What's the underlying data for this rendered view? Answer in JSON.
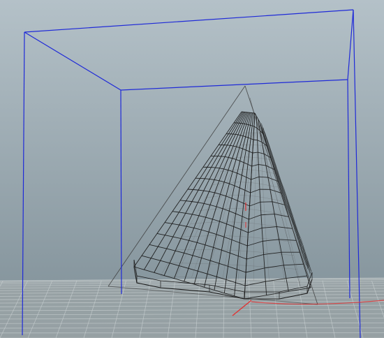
{
  "viewport": {
    "kind": "3d-wireframe-viewport",
    "background_top": "#b4c1c8",
    "background_bottom": "#7e8e96",
    "floor_color": "#9aa3a6",
    "grid_color": "#c9d0d2",
    "bounding_box_color": "#1f2ad8",
    "wireframe_color": "#1a1a1a",
    "guide_color": "#3a3a3a",
    "origin_axis_color": "#e23232"
  },
  "scene": {
    "objects": [
      {
        "name": "wireframe-mesh",
        "shape": "rounded-pyramid"
      },
      {
        "name": "guide-triangle",
        "shape": "triangle"
      },
      {
        "name": "bounding-box",
        "shape": "box"
      },
      {
        "name": "ground-grid",
        "shape": "plane"
      }
    ]
  }
}
